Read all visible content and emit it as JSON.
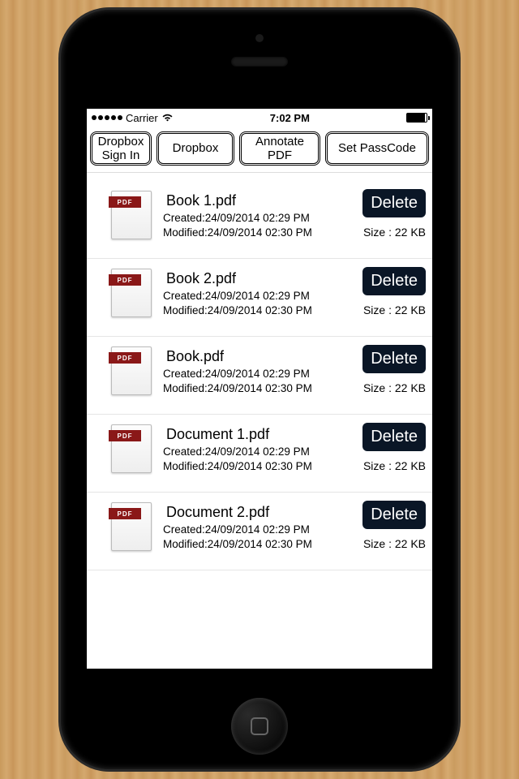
{
  "status": {
    "carrier": "Carrier",
    "time": "7:02 PM"
  },
  "toolbar": {
    "dropbox_signin": "Dropbox\nSign In",
    "dropbox": "Dropbox",
    "annotate": "Annotate\nPDF",
    "set_passcode": "Set PassCode"
  },
  "icon_band": "PDF",
  "files": [
    {
      "name": "Book 1.pdf",
      "created": "Created:24/09/2014 02:29 PM",
      "modified": "Modified:24/09/2014 02:30 PM",
      "delete": "Delete",
      "size": "Size : 22 KB"
    },
    {
      "name": "Book 2.pdf",
      "created": "Created:24/09/2014 02:29 PM",
      "modified": "Modified:24/09/2014 02:30 PM",
      "delete": "Delete",
      "size": "Size : 22 KB"
    },
    {
      "name": "Book.pdf",
      "created": "Created:24/09/2014 02:29 PM",
      "modified": "Modified:24/09/2014 02:30 PM",
      "delete": "Delete",
      "size": "Size : 22 KB"
    },
    {
      "name": "Document 1.pdf",
      "created": "Created:24/09/2014 02:29 PM",
      "modified": "Modified:24/09/2014 02:30 PM",
      "delete": "Delete",
      "size": "Size : 22 KB"
    },
    {
      "name": "Document 2.pdf",
      "created": "Created:24/09/2014 02:29 PM",
      "modified": "Modified:24/09/2014 02:30 PM",
      "delete": "Delete",
      "size": "Size : 22 KB"
    }
  ]
}
